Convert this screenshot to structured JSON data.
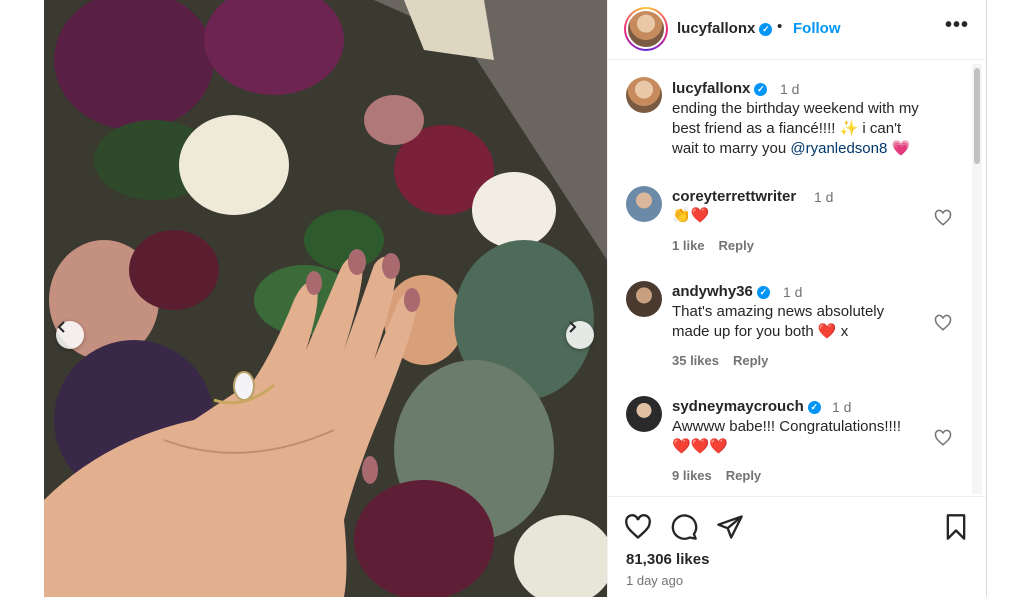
{
  "post": {
    "username": "lucyfallonx",
    "follow_label": "Follow",
    "separator": "•",
    "more_label": "•••",
    "caption_time": "1 d",
    "caption_line1": "ending the birthday weekend with my",
    "caption_line2": "best friend as a fiancé!!!! ✨ i can't",
    "caption_line3_pre": "wait to marry you ",
    "caption_mention": "@ryanledson8",
    "caption_emoji": "💗",
    "likes": "81,306 likes",
    "posted": "1 day ago"
  },
  "comments": [
    {
      "username": "coreyterrettwriter",
      "verified": false,
      "time": "1 d",
      "text": "👏❤️",
      "likes": "1 like",
      "reply": "Reply"
    },
    {
      "username": "andywhy36",
      "verified": true,
      "time": "1 d",
      "text_line1": "That's amazing news absolutely",
      "text_line2": "made up for you both ❤️ x",
      "likes": "35 likes",
      "reply": "Reply"
    },
    {
      "username": "sydneymaycrouch",
      "verified": true,
      "time": "1 d",
      "text_line1": "Awwww babe!!! Congratulations!!!!",
      "text_line2": "❤️❤️❤️",
      "likes": "9 likes",
      "reply": "Reply"
    }
  ],
  "icons": {
    "like": "heart-icon",
    "comment": "comment-icon",
    "share": "share-icon",
    "save": "bookmark-icon",
    "prev": "chevron-left-icon",
    "next": "chevron-right-icon"
  },
  "colors": {
    "link": "#0095f6",
    "verified": "#0095f6",
    "heart_red": "#ed4956"
  }
}
